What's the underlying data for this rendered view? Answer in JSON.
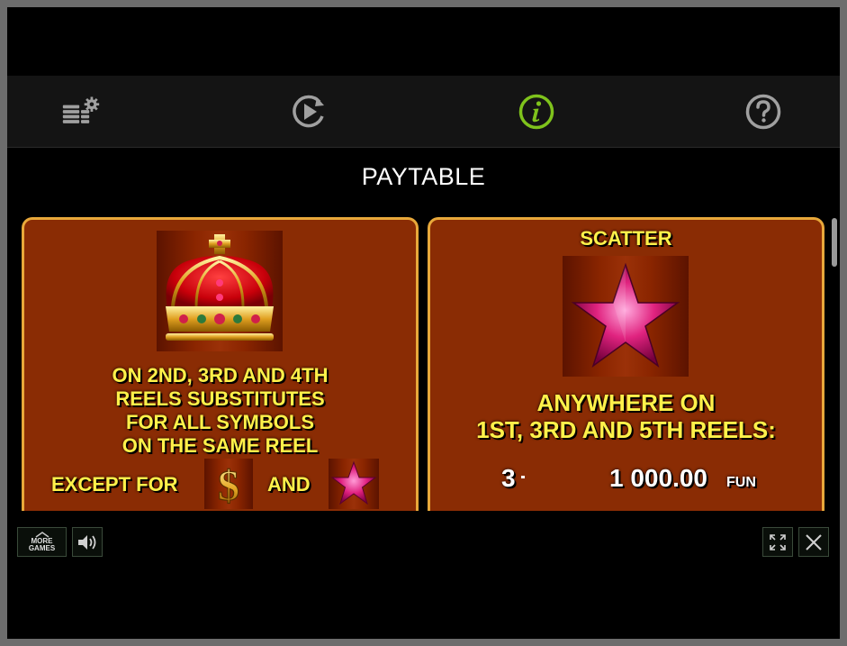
{
  "toolbar": {
    "items": [
      {
        "name": "settings-icon"
      },
      {
        "name": "autoplay-icon"
      },
      {
        "name": "info-icon",
        "active": true
      },
      {
        "name": "help-icon"
      }
    ],
    "active_color": "#7fc31c",
    "icon_color": "#a0a0a0"
  },
  "paytable": {
    "title": "PAYTABLE",
    "wild": {
      "symbol": "crown-icon",
      "lines": [
        "ON 2ND, 3RD AND 4TH",
        "REELS SUBSTITUTES",
        "FOR ALL SYMBOLS",
        "ON THE SAME REEL"
      ],
      "except_label": "EXCEPT FOR",
      "and_label": "AND",
      "except_symbols": [
        "dollar-icon",
        "star-icon"
      ]
    },
    "scatter": {
      "title": "SCATTER",
      "symbol": "star-icon",
      "lines": [
        "ANYWHERE ON",
        "1ST, 3RD AND 5TH REELS:"
      ],
      "pays": [
        {
          "count": "3",
          "amount": "1 000.00",
          "currency": "FUN"
        }
      ]
    }
  },
  "footer": {
    "more_games_line1": "MORE",
    "more_games_line2": "GAMES"
  },
  "colors": {
    "panel_bg": "#8a2c04",
    "panel_border": "#e8a83a",
    "text_yellow": "#fff14a"
  }
}
